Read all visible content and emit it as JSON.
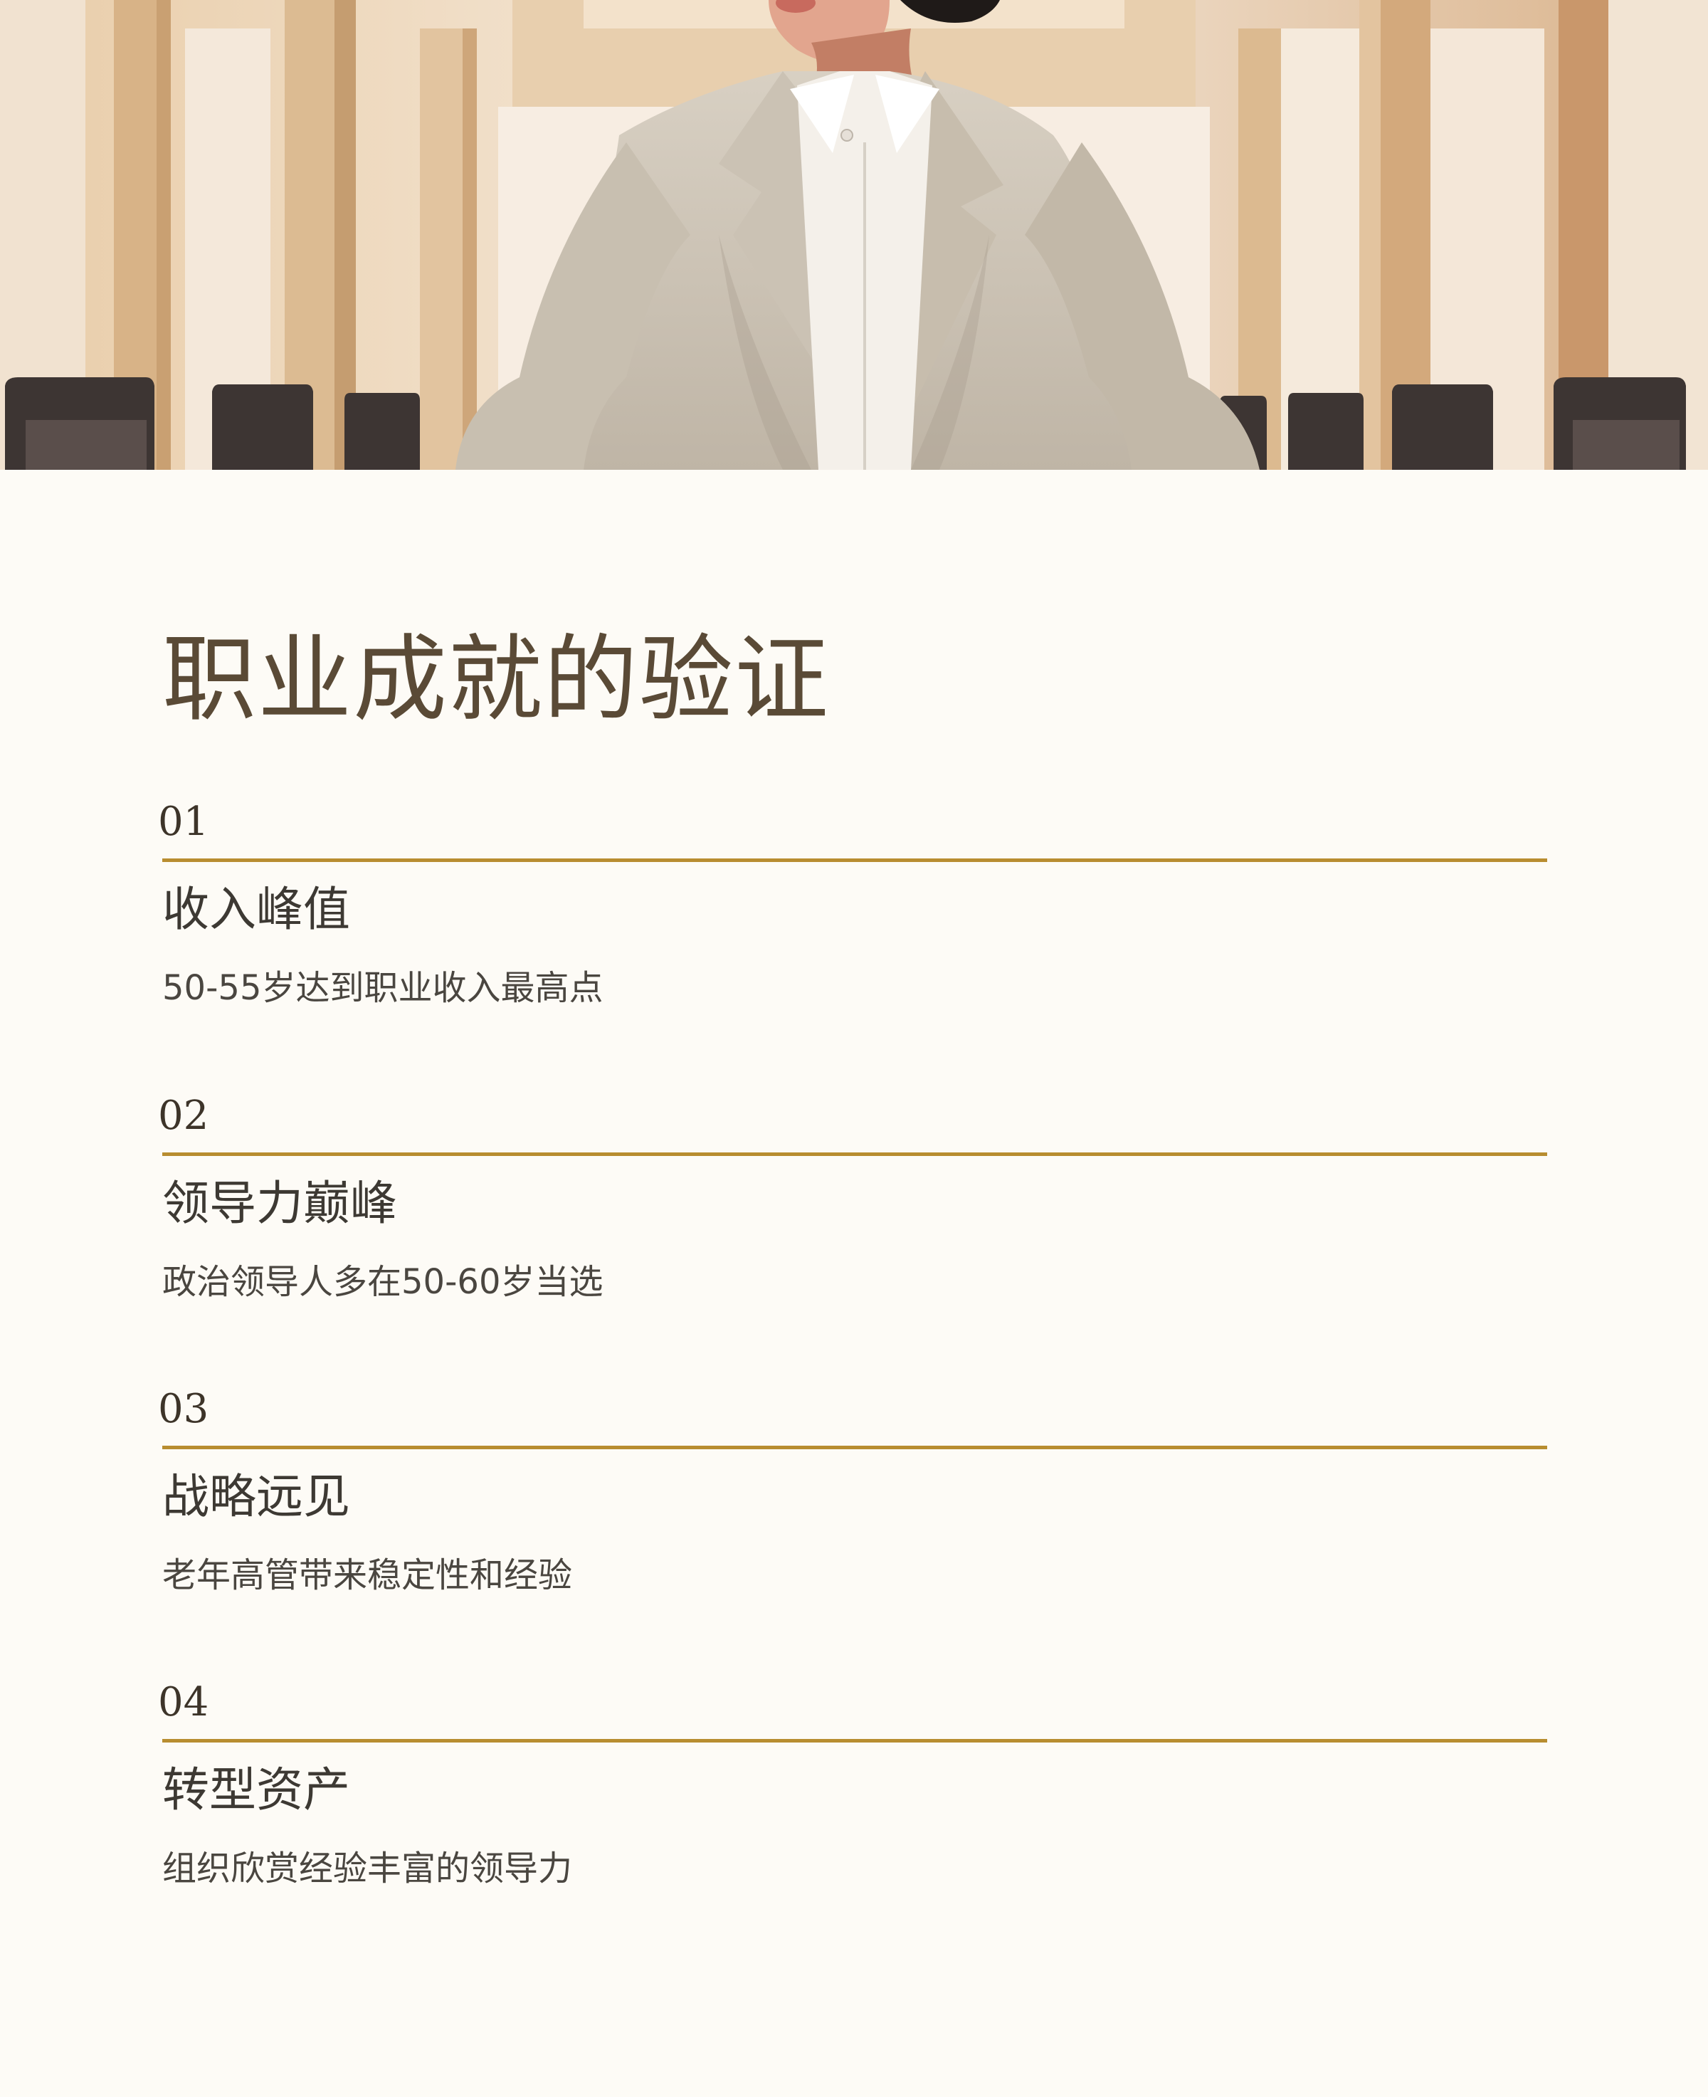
{
  "hero": {
    "image_description": ""
  },
  "page_title": "职业成就的验证",
  "items": [
    {
      "number": "01",
      "title": "收入峰值",
      "desc": "50-55岁达到职业收入最高点"
    },
    {
      "number": "02",
      "title": "领导力巅峰",
      "desc": "政治领导人多在50-60岁当选"
    },
    {
      "number": "03",
      "title": "战略远见",
      "desc": "老年高管带来稳定性和经验"
    },
    {
      "number": "04",
      "title": "转型资产",
      "desc": "组织欣赏经验丰富的领导力"
    }
  ],
  "colors": {
    "background": "#fdfbf6",
    "accent_rule": "#b88d30",
    "title": "#5a4a36",
    "text": "#3d3933"
  }
}
